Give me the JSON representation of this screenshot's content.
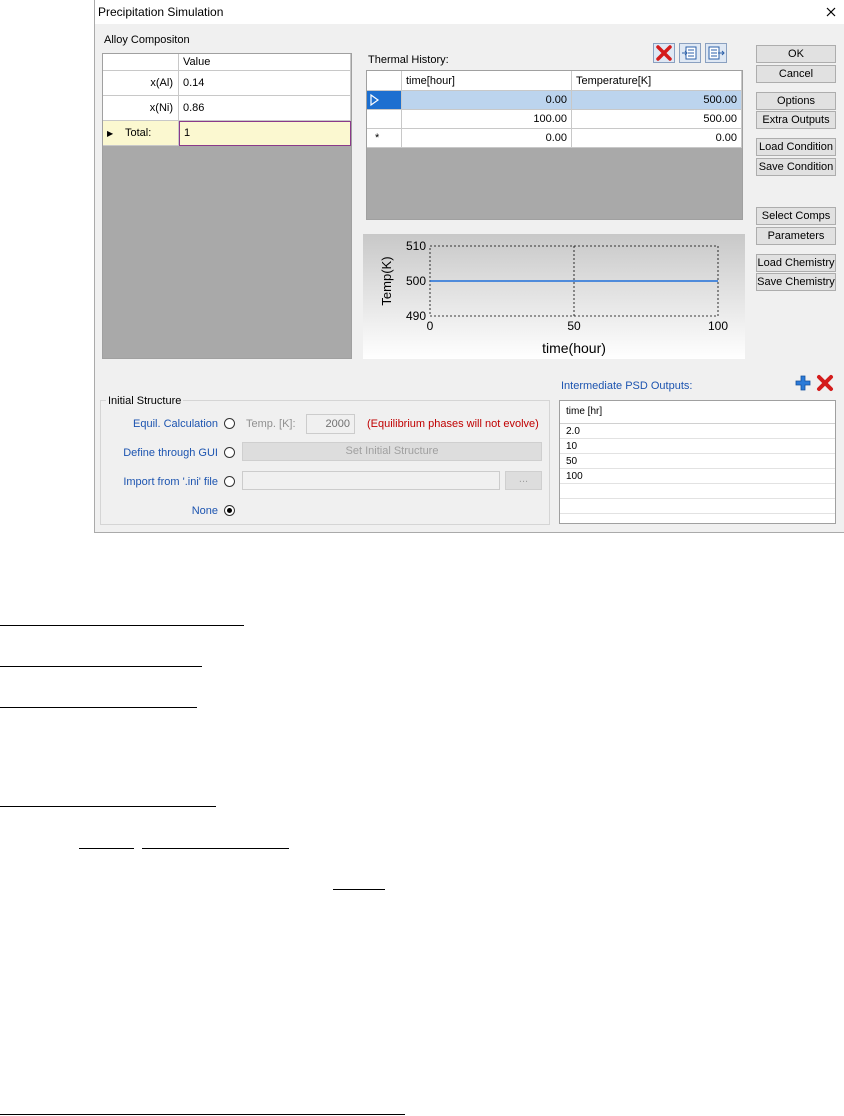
{
  "dialog": {
    "title": "Precipitation Simulation",
    "close_glyph": "✕"
  },
  "alloy": {
    "section_label": "Alloy Compositon",
    "header_value": "Value",
    "rows": [
      {
        "name": "x(Al)",
        "value": "0.14"
      },
      {
        "name": "x(Ni)",
        "value": "0.86"
      }
    ],
    "total_label": "Total:",
    "total_value": "1",
    "row_marker": "▶"
  },
  "thermal": {
    "section_label": "Thermal History:",
    "columns": [
      "time[hour]",
      "Temperature[K]"
    ],
    "rows": [
      {
        "time": "0.00",
        "temp": "500.00"
      },
      {
        "time": "100.00",
        "temp": "500.00"
      },
      {
        "time": "0.00",
        "temp": "0.00"
      }
    ],
    "new_row_marker": "*",
    "toolbar": {
      "delete_icon": "delete-rows-icon",
      "import_icon": "import-table-icon",
      "export_icon": "export-table-icon"
    }
  },
  "buttons": {
    "ok": "OK",
    "cancel": "Cancel",
    "options": "Options",
    "extra_outputs": "Extra Outputs",
    "load_condition": "Load Condition",
    "save_condition": "Save Condition",
    "select_comps": "Select Comps",
    "parameters": "Parameters",
    "load_chemistry": "Load Chemistry",
    "save_chemistry": "Save Chemistry"
  },
  "chart_data": {
    "type": "line",
    "x": [
      0,
      100
    ],
    "series": [
      {
        "values": [
          500,
          500
        ]
      }
    ],
    "xlabel": "time(hour)",
    "ylabel": "Temp(K)",
    "xlim": [
      0,
      100
    ],
    "ylim": [
      490,
      510
    ],
    "xticks": [
      "0",
      "50",
      "100"
    ],
    "yticks": [
      "510",
      "500",
      "490"
    ],
    "grid": "dashed",
    "line_color": "#1e6fd9"
  },
  "initial_structure": {
    "group_label": "Initial Structure",
    "equil_label": "Equil. Calculation",
    "temp_label": "Temp. [K]:",
    "temp_value": "2000",
    "warning": "(Equilibrium phases will not evolve)",
    "gui_label": "Define through GUI",
    "set_button": "Set Initial Structure",
    "ini_label": "Import from '.ini' file",
    "ini_path": "",
    "browse_button": "...",
    "none_label": "None",
    "selected": "None"
  },
  "psd": {
    "label": "Intermediate PSD Outputs:",
    "header": "time [hr]",
    "rows": [
      "2.0",
      "10",
      "50",
      "100"
    ],
    "add_icon": "plus-icon",
    "delete_icon": "delete-icon"
  },
  "colors": {
    "selected_row": "#bcd4ee",
    "total_row": "#fbf8d0",
    "warning_red": "#c00000",
    "link_blue": "#1c54b0"
  }
}
